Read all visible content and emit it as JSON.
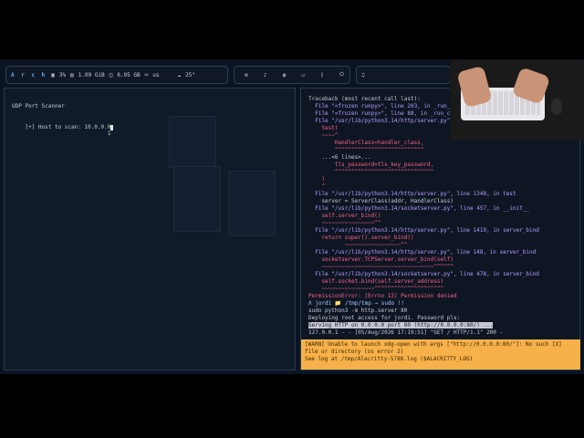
{
  "topbar": {
    "left": {
      "logo": "A r c h",
      "cpu": "3%",
      "mem": "1.09 GiB",
      "disk": "6.95 GB",
      "locale": "us",
      "weather": "25°"
    },
    "mid_icons": [
      "gear-icon",
      "bell-icon",
      "globe-icon",
      "monitor-icon",
      "bluetooth-icon",
      "power-icon"
    ],
    "right_icon": "music-icon"
  },
  "left_terminal": {
    "title": "UDP Port Scanner",
    "prompt": "[+] Host to scan: 10.0.0.0"
  },
  "right_terminal": {
    "lines": [
      {
        "text": "Traceback (most recent call last):",
        "cls": "muted"
      },
      {
        "text": "  File \"<frozen runpy>\", line 203, in _run_m",
        "cls": "path"
      },
      {
        "text": "  File \"<frozen runpy>\", line 88, in _run_co",
        "cls": "path"
      },
      {
        "text": "  File \"/usr/lib/python3.14/http/server.py\",",
        "cls": "path"
      },
      {
        "text": "    test(",
        "cls": "err"
      },
      {
        "text": "    ~~~~^",
        "cls": "und"
      },
      {
        "text": "        HandlerClass=handler_class,",
        "cls": "err"
      },
      {
        "text": "        ^^^^^^^^^^^^^^^^^^^^^^^^^^^",
        "cls": "und"
      },
      {
        "text": "    ...<6 lines>...",
        "cls": "muted"
      },
      {
        "text": "        tls_password=tls_key_password,",
        "cls": "err"
      },
      {
        "text": "        ^^^^^^^^^^^^^^^^^^^^^^^^^^^^^^",
        "cls": "und"
      },
      {
        "text": "    )",
        "cls": "err"
      },
      {
        "text": "    ^",
        "cls": "und"
      },
      {
        "text": "  File \"/usr/lib/python3.14/http/server.py\", line 1348, in test",
        "cls": "path"
      },
      {
        "text": "    server = ServerClass(addr, HandlerClass)",
        "cls": "muted"
      },
      {
        "text": "  File \"/usr/lib/python3.14/socketserver.py\", line 457, in __init__",
        "cls": "path"
      },
      {
        "text": "    self.server_bind()",
        "cls": "err"
      },
      {
        "text": "    ~~~~~~~~~~~~~~~~^^",
        "cls": "und"
      },
      {
        "text": "  File \"/usr/lib/python3.14/http/server.py\", line 1419, in server_bind",
        "cls": "path"
      },
      {
        "text": "    return super().server_bind()",
        "cls": "err"
      },
      {
        "text": "           ~~~~~~~~~~~~~~~~~^^",
        "cls": "und"
      },
      {
        "text": "  File \"/usr/lib/python3.14/http/server.py\", line 148, in server_bind",
        "cls": "path"
      },
      {
        "text": "    socketserver.TCPServer.server_bind(self)",
        "cls": "err"
      },
      {
        "text": "    ~~~~~~~~~~~~~~~~~~~~~~~~~~~~~~~~~~^^^^^^",
        "cls": "und"
      },
      {
        "text": "  File \"/usr/lib/python3.14/socketserver.py\", line 478, in server_bind",
        "cls": "path"
      },
      {
        "text": "    self.socket.bind(self.server_address)",
        "cls": "err"
      },
      {
        "text": "    ~~~~~~~~~~~~~~~~^^^^^^^^^^^^^^^^^^^^^",
        "cls": "und"
      },
      {
        "text": "PermissionError: [Errno 13] Permission denied",
        "cls": "err"
      },
      {
        "text": "Λ jordi 📁 /tmp/tmp → sudo !!",
        "cls": "kw"
      },
      {
        "text": "sudo python3 -m http.server 80",
        "cls": "muted"
      },
      {
        "text": "Deploying root access for jordi. Password pls:",
        "cls": "muted"
      },
      {
        "text": "Serving HTTP on 0.0.0.0 port 80 (http://0.0.0.0:80/) ...",
        "cls": "hl"
      },
      {
        "text": "127.0.0.1 - - [05/Aug/2026 17:19:51] \"GET / HTTP/1.1\" 200 -",
        "cls": "muted"
      }
    ]
  },
  "toast": {
    "text": "[WARN] Unable to launch xdg-open with args [\"http://0.0.0.0:80/\"]: No such [X]\nfile or directory (os error 2)\nSee log at /tmp/Alacritty-5788.log ($ALACRITTY_LOG)"
  }
}
